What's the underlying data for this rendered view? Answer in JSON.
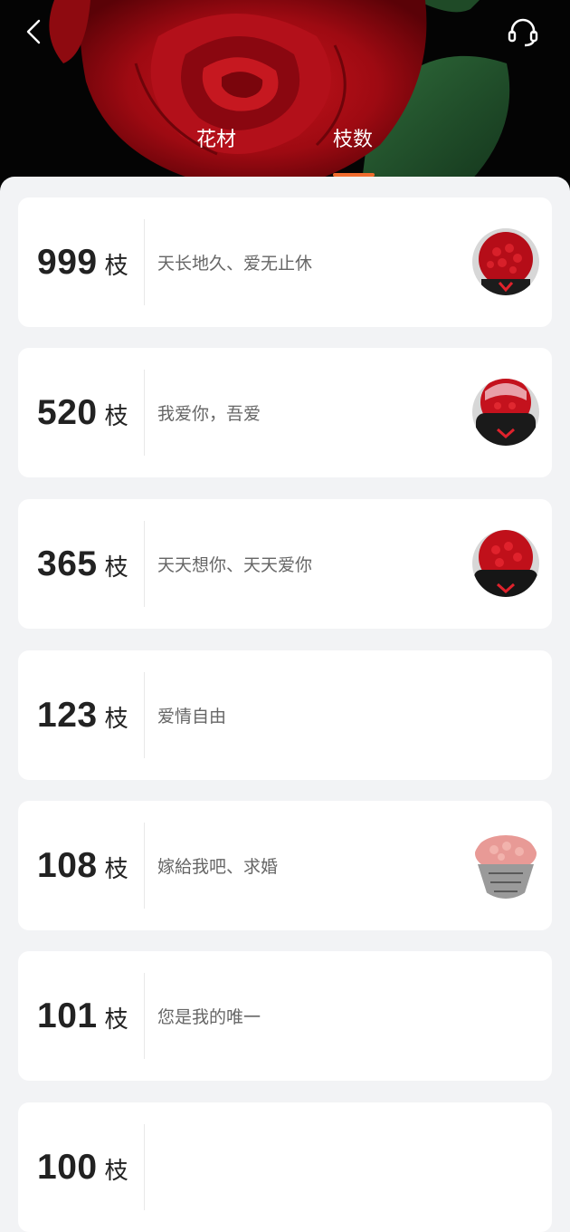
{
  "header": {
    "back_icon": "chevron-left-icon",
    "service_icon": "headset-icon",
    "tabs": [
      {
        "label": "花材",
        "active": false
      },
      {
        "label": "枝数",
        "active": true
      }
    ],
    "accent_color": "#f06b2e"
  },
  "items": [
    {
      "count": "999",
      "unit": "枝",
      "desc": "天长地久、爱无止休",
      "has_image": true
    },
    {
      "count": "520",
      "unit": "枝",
      "desc": "我爱你，吾爱",
      "has_image": true
    },
    {
      "count": "365",
      "unit": "枝",
      "desc": "天天想你、天天爱你",
      "has_image": true
    },
    {
      "count": "123",
      "unit": "枝",
      "desc": "爱情自由",
      "has_image": false
    },
    {
      "count": "108",
      "unit": "枝",
      "desc": "嫁給我吧、求婚",
      "has_image": true
    },
    {
      "count": "101",
      "unit": "枝",
      "desc": "您是我的唯一",
      "has_image": false
    },
    {
      "count": "100",
      "unit": "枝",
      "desc": "",
      "has_image": false
    }
  ]
}
